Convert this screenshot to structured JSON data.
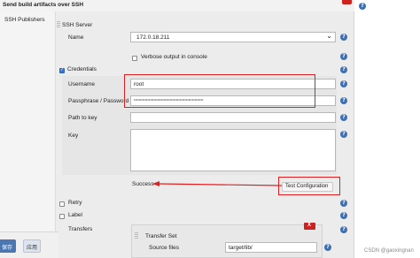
{
  "section": {
    "title": "Send build artifacts over SSH"
  },
  "sidebar": {
    "publishers_label": "SSH Publishers"
  },
  "ssh_server": {
    "header": "SSH Server",
    "name_label": "Name",
    "name_value": "172.0.18.211",
    "verbose_label": "Verbose output in console"
  },
  "credentials": {
    "label": "Credentials",
    "username_label": "Username",
    "username_value": "root",
    "password_label": "Passphrase / Password",
    "password_value": "••••••••••••••••••••••••••••••••••••••••••••••••••••••••",
    "path_label": "Path to key",
    "key_label": "Key"
  },
  "test": {
    "status": "Success",
    "button_label": "Test Configuration"
  },
  "options": {
    "retry_label": "Retry",
    "label_label": "Label",
    "transfers_label": "Transfers"
  },
  "transfer_set": {
    "header": "Transfer Set",
    "source_files_label": "Source files",
    "source_files_value": "target/lib/",
    "delete_glyph": "X"
  },
  "footer": {
    "save_label": "保存",
    "apply_label": "应用"
  },
  "watermark": "CSDN @gaoxingnan",
  "icons": {
    "help": "?",
    "dropdown": "⌄"
  },
  "colors": {
    "help_icon": "#3d6fb4",
    "annotation_red": "#e02020",
    "delete_red": "#cc2222",
    "save_blue": "#4b76b0"
  }
}
